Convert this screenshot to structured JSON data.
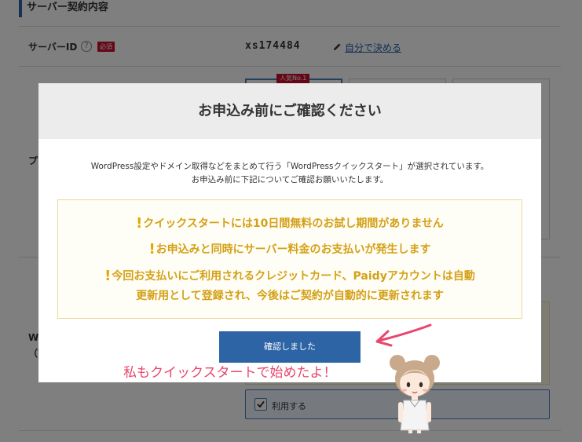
{
  "background": {
    "section_title": "サーバー契約内容",
    "server_id_label": "サーバーID",
    "required_badge": "必須",
    "server_id_value": "xs174484",
    "custom_link": "自分で決める",
    "popular_tag": "人気No.1",
    "plan_label_partial": "プ",
    "wp_label_partial_1": "W",
    "wp_label_partial_2": "（W",
    "use_label": "利用する",
    "use_checked": true
  },
  "modal": {
    "title": "お申込み前にご確認ください",
    "description_line1": "WordPress設定やドメイン取得などをまとめて行う「WordPressクイックスタート」が選択されています。",
    "description_line2": "お申込み前に下記についてご確認お願いいたします。",
    "notices": [
      "クイックスタートには10日間無料のお試し期間がありません",
      "お申込みと同時にサーバー料金のお支払いが発生します",
      "今回お支払いにご利用されるクレジットカード、Paidyアカウントは自動"
    ],
    "notice_continuation": "更新用として登録され、今後はご契約が自動的に更新されます",
    "exclamation": "!",
    "confirm_button": "確認しました"
  },
  "annotation": {
    "text": "私もクイックスタートで始めたよ！"
  },
  "colors": {
    "accent_blue": "#2d64a6",
    "notice_gold": "#d4a017",
    "required_red": "#c8102e",
    "annotation_pink": "#e8486d"
  },
  "icons": [
    "help-icon",
    "pencil-icon",
    "check-icon",
    "exclamation-icon",
    "arrow-annotation",
    "mascot-illustration"
  ]
}
